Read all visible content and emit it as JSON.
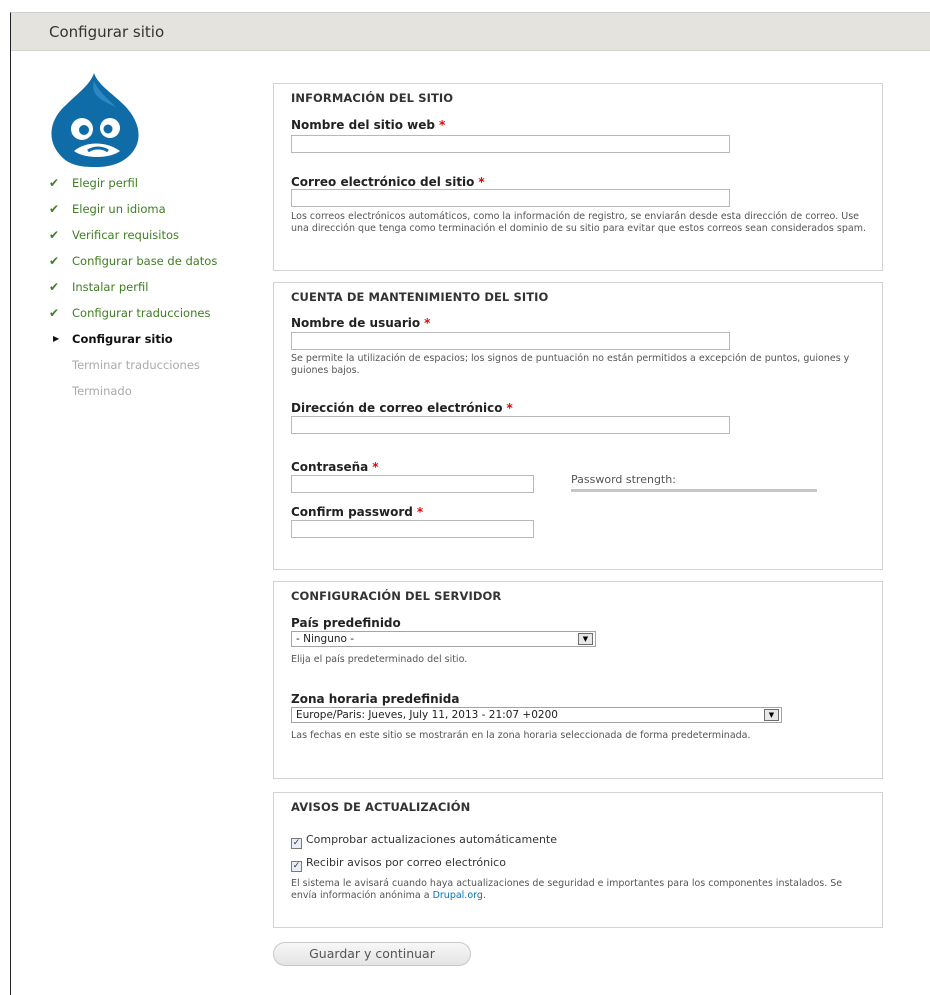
{
  "header": {
    "title": "Configurar sitio"
  },
  "steps": [
    {
      "label": "Elegir perfil",
      "state": "done"
    },
    {
      "label": "Elegir un idioma",
      "state": "done"
    },
    {
      "label": "Verificar requisitos",
      "state": "done"
    },
    {
      "label": "Configurar base de datos",
      "state": "done"
    },
    {
      "label": "Instalar perfil",
      "state": "done"
    },
    {
      "label": "Configurar traducciones",
      "state": "done"
    },
    {
      "label": "Configurar sitio",
      "state": "active"
    },
    {
      "label": "Terminar traducciones",
      "state": "pending"
    },
    {
      "label": "Terminado",
      "state": "pending"
    }
  ],
  "site_info": {
    "legend": "INFORMACIÓN DEL SITIO",
    "site_name_label": "Nombre del sitio web",
    "site_name_value": "",
    "site_mail_label": "Correo electrónico del sitio",
    "site_mail_value": "",
    "site_mail_desc": "Los correos electrónicos automáticos, como la información de registro, se enviarán desde esta dirección de correo. Use una dirección que tenga como terminación el dominio de su sitio para evitar que estos correos sean considerados spam."
  },
  "account": {
    "legend": "CUENTA DE MANTENIMIENTO DEL SITIO",
    "username_label": "Nombre de usuario",
    "username_value": "",
    "username_desc": "Se permite la utilización de espacios; los signos de puntuación no están permitidos a excepción de puntos, guiones y guiones bajos.",
    "email_label": "Dirección de correo electrónico",
    "email_value": "",
    "password_label": "Contraseña",
    "password_strength": "Password strength:",
    "confirm_label": "Confirm password"
  },
  "server": {
    "legend": "CONFIGURACIÓN DEL SERVIDOR",
    "country_label": "País predefinido",
    "country_value": "- Ninguno -",
    "country_desc": "Elija el país predeterminado del sitio.",
    "timezone_label": "Zona horaria predefinida",
    "timezone_value": "Europe/Paris: Jueves, July 11, 2013 - 21:07 +0200",
    "timezone_desc": "Las fechas en este sitio se mostrarán en la zona horaria seleccionada de forma predeterminada."
  },
  "updates": {
    "legend": "AVISOS DE ACTUALIZACIÓN",
    "check_label": "Comprobar actualizaciones automáticamente",
    "check_checked": true,
    "notify_label": "Recibir avisos por correo electrónico",
    "notify_checked": true,
    "desc_pre": "El sistema le avisará cuando haya actualizaciones de seguridad e importantes para los componentes instalados. Se envía información anónima a ",
    "desc_link": "Drupal.org",
    "desc_post": "."
  },
  "submit_label": "Guardar y continuar",
  "icons": {
    "check": "checkmark-icon",
    "current": "triangle-right-icon",
    "select": "dropdown-arrow-icon"
  },
  "colors": {
    "done": "#3f7e22",
    "link": "#0074bd",
    "required": "#e00000",
    "logo": "#0f6ca7"
  }
}
